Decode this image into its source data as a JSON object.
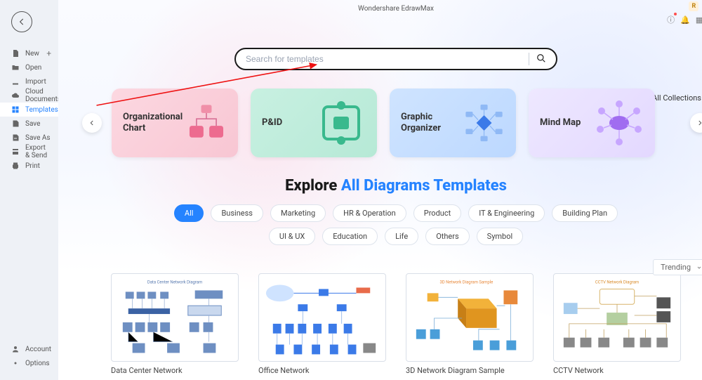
{
  "app": {
    "title": "Wondershare EdrawMax",
    "avatar_initial": "R"
  },
  "sidebar": {
    "items": [
      {
        "label": "New",
        "icon": "file-plus"
      },
      {
        "label": "Open",
        "icon": "folder"
      },
      {
        "label": "Import",
        "icon": "import"
      },
      {
        "label": "Cloud Documents",
        "icon": "cloud"
      },
      {
        "label": "Templates",
        "icon": "templates"
      },
      {
        "label": "Save",
        "icon": "save"
      },
      {
        "label": "Save As",
        "icon": "save-as"
      },
      {
        "label": "Export & Send",
        "icon": "export"
      },
      {
        "label": "Print",
        "icon": "print"
      }
    ],
    "bottom": [
      {
        "label": "Account",
        "icon": "user"
      },
      {
        "label": "Options",
        "icon": "gear"
      }
    ],
    "active_index": 4
  },
  "search": {
    "placeholder": "Search for templates"
  },
  "all_collections_label": "All Collections",
  "carousel": [
    {
      "label": "Organizational Chart",
      "tone": "pink"
    },
    {
      "label": "P&ID",
      "tone": "green"
    },
    {
      "label": "Graphic Organizer",
      "tone": "blue"
    },
    {
      "label": "Mind Map",
      "tone": "purple"
    }
  ],
  "explore": {
    "prefix": "Explore ",
    "accent": "All Diagrams Templates"
  },
  "filters": {
    "row1": [
      "All",
      "Business",
      "Marketing",
      "HR & Operation",
      "Product",
      "IT & Engineering",
      "Building Plan"
    ],
    "row2": [
      "UI & UX",
      "Education",
      "Life",
      "Others",
      "Symbol"
    ],
    "active": "All"
  },
  "sort": {
    "label": "Trending"
  },
  "templates": [
    {
      "title": "Data Center Network"
    },
    {
      "title": "Office Network"
    },
    {
      "title": "3D Network Diagram Sample"
    },
    {
      "title": "CCTV Network"
    }
  ]
}
